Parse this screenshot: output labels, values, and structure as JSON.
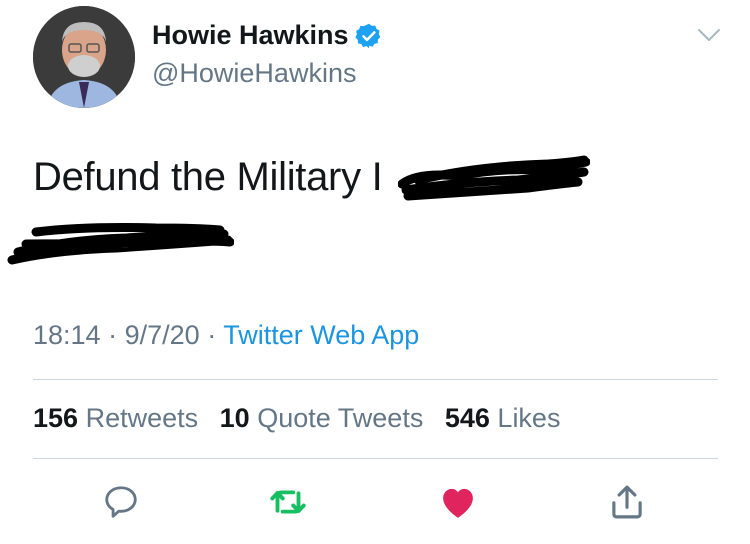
{
  "user": {
    "display_name": "Howie Hawkins",
    "handle": "@HowieHawkins",
    "verified": true
  },
  "tweet": {
    "text_visible": "Defund the Military I"
  },
  "meta": {
    "time": "18:14",
    "date": "9/7/20",
    "separator": "·",
    "source": "Twitter Web App"
  },
  "stats": {
    "retweets": {
      "count": "156",
      "label": "Retweets"
    },
    "quote_tweets": {
      "count": "10",
      "label": "Quote Tweets"
    },
    "likes": {
      "count": "546",
      "label": "Likes"
    }
  },
  "actions": {
    "reply": "reply-icon",
    "retweet": "retweet-icon",
    "like": "heart-icon",
    "share": "share-icon"
  },
  "colors": {
    "name": "#14171a",
    "secondary": "#657786",
    "link": "#1b95e0",
    "verified": "#1da1f2",
    "retweet_green": "#17bf63",
    "like_red": "#e0245e",
    "divider": "#ccd6dd"
  }
}
